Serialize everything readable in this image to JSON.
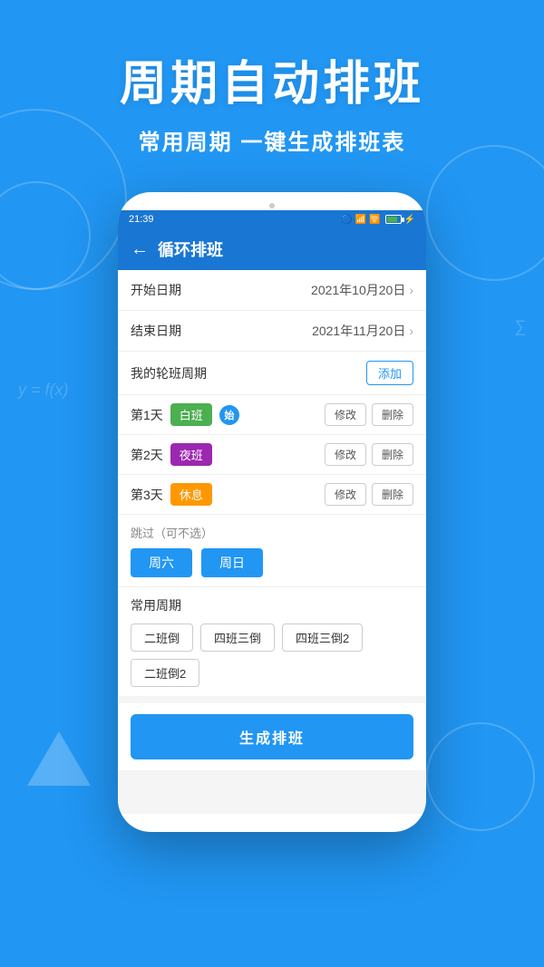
{
  "background": {
    "color": "#2196F3"
  },
  "header": {
    "main_title": "周期自动排班",
    "sub_title": "常用周期 一键生成排班表"
  },
  "status_bar": {
    "time": "21:39",
    "right_icons": "🔵 ℹ ..."
  },
  "app_header": {
    "back_label": "←",
    "title": "循环排班"
  },
  "start_date": {
    "label": "开始日期",
    "value": "2021年10月20日"
  },
  "end_date": {
    "label": "结束日期",
    "value": "2021年11月20日"
  },
  "my_shifts": {
    "label": "我的轮班周期",
    "add_btn": "添加"
  },
  "shifts": [
    {
      "day": "第1天",
      "tag": "白班",
      "tag_class": "tag-white",
      "has_start": true,
      "modify": "修改",
      "delete": "删除"
    },
    {
      "day": "第2天",
      "tag": "夜班",
      "tag_class": "tag-night",
      "has_start": false,
      "modify": "修改",
      "delete": "删除"
    },
    {
      "day": "第3天",
      "tag": "休息",
      "tag_class": "tag-rest",
      "has_start": false,
      "modify": "修改",
      "delete": "删除"
    }
  ],
  "skip_section": {
    "label": "跳过（可不选）",
    "buttons": [
      "周六",
      "周日"
    ]
  },
  "common_periods": {
    "label": "常用周期",
    "buttons": [
      "二班倒",
      "四班三倒",
      "四班三倒2",
      "二班倒2"
    ]
  },
  "generate_btn": "生成排班"
}
